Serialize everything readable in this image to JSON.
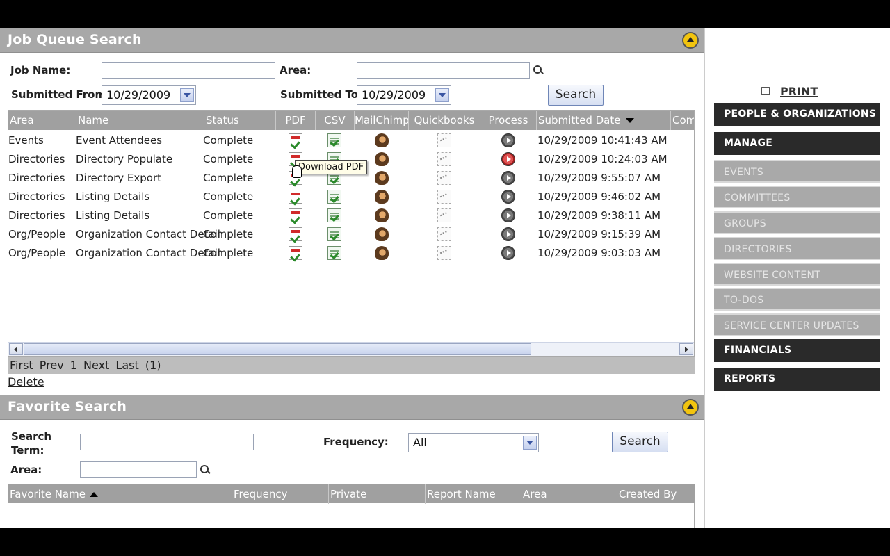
{
  "job_queue": {
    "title": "Job Queue Search",
    "job_name_label": "Job Name:",
    "job_name_value": "",
    "area_label": "Area:",
    "area_value": "",
    "submitted_from_label": "Submitted From:",
    "submitted_from_value": "10/29/2009",
    "submitted_to_label": "Submitted To:",
    "submitted_to_value": "10/29/2009",
    "search_button": "Search",
    "columns": [
      "Area",
      "Name",
      "Status",
      "PDF",
      "CSV",
      "MailChimp",
      "Quickbooks",
      "Process",
      "Submitted Date",
      "Com"
    ],
    "rows": [
      {
        "area": "Events",
        "name": "Event Attendees",
        "status": "Complete",
        "date": "10/29/2009 10:41:43 AM",
        "process": "gray"
      },
      {
        "area": "Directories",
        "name": "Directory Populate",
        "status": "Complete",
        "date": "10/29/2009 10:24:03 AM",
        "process": "red"
      },
      {
        "area": "Directories",
        "name": "Directory Export",
        "status": "Complete",
        "date": "10/29/2009 9:55:07 AM",
        "process": "gray"
      },
      {
        "area": "Directories",
        "name": "Listing Details",
        "status": "Complete",
        "date": "10/29/2009 9:46:02 AM",
        "process": "gray"
      },
      {
        "area": "Directories",
        "name": "Listing Details",
        "status": "Complete",
        "date": "10/29/2009 9:38:11 AM",
        "process": "gray"
      },
      {
        "area": "Org/People",
        "name": "Organization Contact Detail",
        "status": "Complete",
        "date": "10/29/2009 9:15:39 AM",
        "process": "gray"
      },
      {
        "area": "Org/People",
        "name": "Organization Contact Detail",
        "status": "Complete",
        "date": "10/29/2009 9:03:03 AM",
        "process": "gray"
      }
    ],
    "tooltip": "Download PDF",
    "pager": {
      "first": "First",
      "prev": "Prev",
      "page": "1",
      "next": "Next",
      "last": "Last",
      "count": "(1)"
    },
    "delete_label": "Delete"
  },
  "favorite": {
    "title": "Favorite Search",
    "search_term_label_1": "Search",
    "search_term_label_2": "Term:",
    "search_term_value": "",
    "frequency_label": "Frequency:",
    "frequency_value": "All",
    "area_label": "Area:",
    "area_value": "",
    "search_button": "Search",
    "columns": [
      "Favorite Name",
      "Frequency",
      "Private",
      "Report Name",
      "Area",
      "Created By"
    ]
  },
  "sidebar": {
    "print_label": "PRINT",
    "items": [
      {
        "label": "PEOPLE & ORGANIZATIONS",
        "style": "dark"
      },
      {
        "label": "MANAGE",
        "style": "dark"
      },
      {
        "label": "EVENTS",
        "style": "light"
      },
      {
        "label": "COMMITTEES",
        "style": "light"
      },
      {
        "label": "GROUPS",
        "style": "light"
      },
      {
        "label": "DIRECTORIES",
        "style": "light"
      },
      {
        "label": "WEBSITE CONTENT",
        "style": "light"
      },
      {
        "label": "TO-DOS",
        "style": "light"
      },
      {
        "label": "SERVICE CENTER UPDATES",
        "style": "light"
      },
      {
        "label": "FINANCIALS",
        "style": "dark"
      },
      {
        "label": "REPORTS",
        "style": "dark"
      }
    ]
  },
  "colors": {
    "panel_header": "#a8a8a8",
    "grid_header": "#a0a0a0",
    "nav_dark": "#2a2a2a",
    "nav_light": "#a9a9a9",
    "collapse_button": "#f2c40f",
    "process_error": "#a32020"
  }
}
